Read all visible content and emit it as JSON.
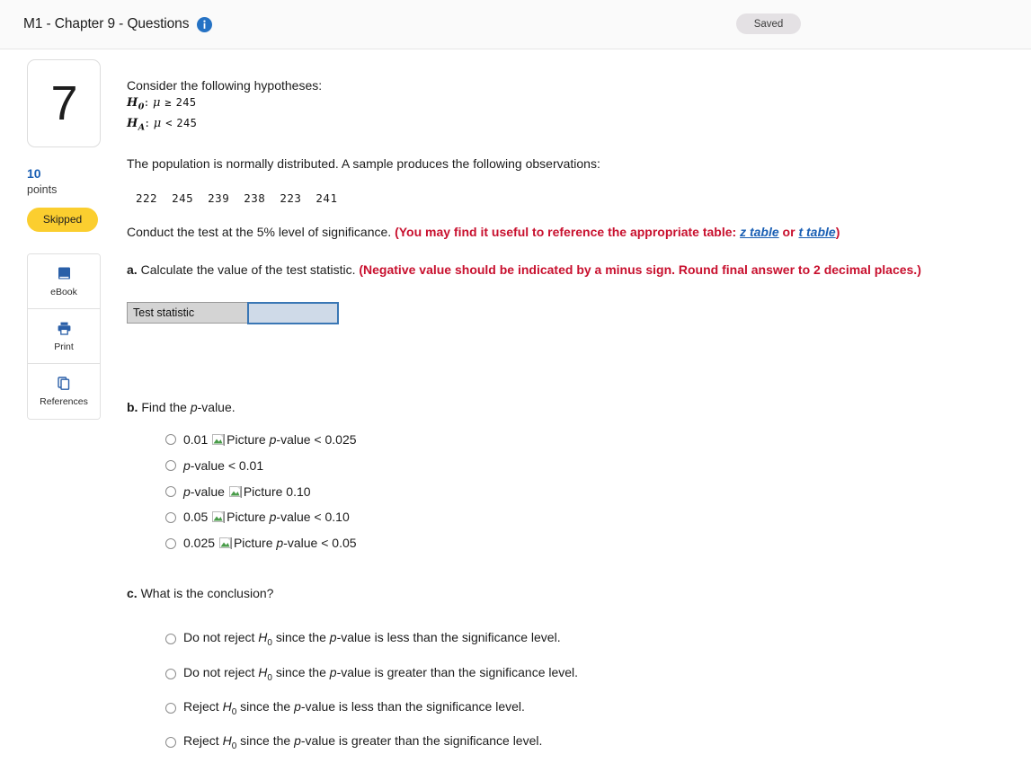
{
  "header": {
    "title": "M1 - Chapter 9 - Questions",
    "info_icon": "info-icon",
    "saved_label": "Saved"
  },
  "sidebar": {
    "question_number": "7",
    "points_value": "10",
    "points_label": "points",
    "status": "Skipped",
    "status_color": "#fbce2f",
    "tools": [
      {
        "label": "eBook",
        "icon": "ebook-icon"
      },
      {
        "label": "Print",
        "icon": "printer-icon"
      },
      {
        "label": "References",
        "icon": "references-icon"
      }
    ]
  },
  "question": {
    "intro": "Consider the following hypotheses:",
    "hypotheses": [
      {
        "symbol": "H",
        "sub": "0",
        "relation": "≥",
        "value": "245"
      },
      {
        "symbol": "H",
        "sub": "A",
        "relation": "<",
        "value": "245"
      }
    ],
    "mu": "μ",
    "population_line": "The population is normally distributed. A sample produces the following observations:",
    "observations": [
      "222",
      "245",
      "239",
      "238",
      "223",
      "241"
    ],
    "conduct_plain": "Conduct the test at the 5% level of significance. ",
    "conduct_red_open": "(You may find it useful to reference the appropriate table: ",
    "z_table_link": "z table",
    "link_or": " or ",
    "t_table_link": "t table",
    "conduct_red_close": ")"
  },
  "part_a": {
    "label": "a.",
    "prompt": " Calculate the value of the test statistic. ",
    "note": "(Negative value should be indicated by a minus sign. Round final answer to 2 decimal places.)",
    "table": {
      "row_label": "Test statistic",
      "input_value": "",
      "input_border_color": "#3a77b5",
      "input_fill_color": "#cfdae8",
      "label_fill_color": "#d4d4d4"
    }
  },
  "part_b": {
    "label": "b.",
    "prompt": " Find the ",
    "prompt_italic": "p",
    "prompt_tail": "-value.",
    "options": [
      {
        "id": "b1",
        "text": "0.01 |PIC| p-value < 0.025",
        "selected": false
      },
      {
        "id": "b2",
        "text": "p-value < 0.01",
        "selected": false
      },
      {
        "id": "b3",
        "text": "p-value |PIC| 0.10",
        "selected": false
      },
      {
        "id": "b4",
        "text": "0.05 |PIC| p-value < 0.10",
        "selected": false
      },
      {
        "id": "b5",
        "text": "0.025 |PIC| p-value < 0.05",
        "selected": false
      }
    ],
    "broken_image_alt": "Picture"
  },
  "part_c": {
    "label": "c.",
    "prompt": " What is the conclusion?",
    "options": [
      {
        "id": "c1",
        "text": "Do not reject H0 since the p-value is less than the significance level.",
        "selected": false
      },
      {
        "id": "c2",
        "text": "Do not reject H0 since the p-value is greater than the significance level.",
        "selected": false
      },
      {
        "id": "c3",
        "text": "Reject H0 since the p-value is less than the significance level.",
        "selected": false
      },
      {
        "id": "c4",
        "text": "Reject H0 since the p-value is greater than the significance level.",
        "selected": false
      }
    ]
  }
}
